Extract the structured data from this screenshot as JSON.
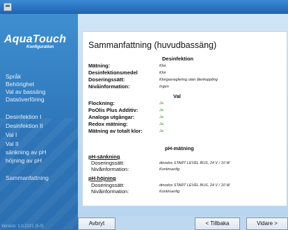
{
  "window": {
    "title": ""
  },
  "sidebar": {
    "logo": "AquaTouch",
    "logo_sub": "Konfiguration",
    "items": [
      {
        "label": "Språk"
      },
      {
        "label": "Behörighet"
      },
      {
        "label": "Val av bassäng"
      },
      {
        "label": "Dataöverföring"
      },
      {
        "label": "Desinfektion I"
      },
      {
        "label": "Desinfektion II"
      },
      {
        "label": "Val I"
      },
      {
        "label": "Val II"
      },
      {
        "label": "sänkning av pH"
      },
      {
        "label": "höjning av pH"
      },
      {
        "label": "Sammanfattning"
      }
    ],
    "version": "Version: 1.0.2221 (5.0)"
  },
  "summary": {
    "title": "Sammanfattning (huvudbassäng)",
    "disinfection": {
      "heading": "Desinfektion",
      "rows": [
        {
          "label": "Mätning:",
          "value": "Klor"
        },
        {
          "label": "Desinfektionsmedel",
          "value": "Klor"
        },
        {
          "label": "Doseringssätt:",
          "value": "Klorgasreglering utan återkoppling"
        },
        {
          "label": "Nivåinformation:",
          "value": "Ingen"
        }
      ]
    },
    "options": {
      "heading": "Val",
      "rows": [
        {
          "label": "Flockning:",
          "value": "Ja"
        },
        {
          "label": "PoOlis Plus Additiv:",
          "value": "Ja"
        },
        {
          "label": "Analoga utgångar:",
          "value": "Ja"
        },
        {
          "label": "Redox mätning:",
          "value": "Ja"
        },
        {
          "label": "Mätning av totalt klor:",
          "value": "Ja"
        }
      ]
    },
    "ph": {
      "heading": "pH-mätning",
      "lowering": {
        "heading": "pH-sänkning",
        "rows": [
          {
            "label": "Doseringssätt:",
            "value": "dinodos START LEVEL BUS, 24 V / 10 W"
          },
          {
            "label": "Nivåinformation:",
            "value": "Kontinuerlig"
          }
        ]
      },
      "raising": {
        "heading": "pH-höjning",
        "rows": [
          {
            "label": "Doseringssätt:",
            "value": "dinodos START LEVEL BUS, 24 V / 10 W"
          },
          {
            "label": "Nivåinformation:",
            "value": "Kontinuerlig"
          }
        ]
      }
    }
  },
  "buttons": {
    "cancel": "Avbryt",
    "back": "< Tillbaka",
    "next": "Vidare >"
  },
  "colors": {
    "accent": "#2f79b8",
    "yes_value": "#1f9a1f",
    "close_button": "#d9532f"
  }
}
